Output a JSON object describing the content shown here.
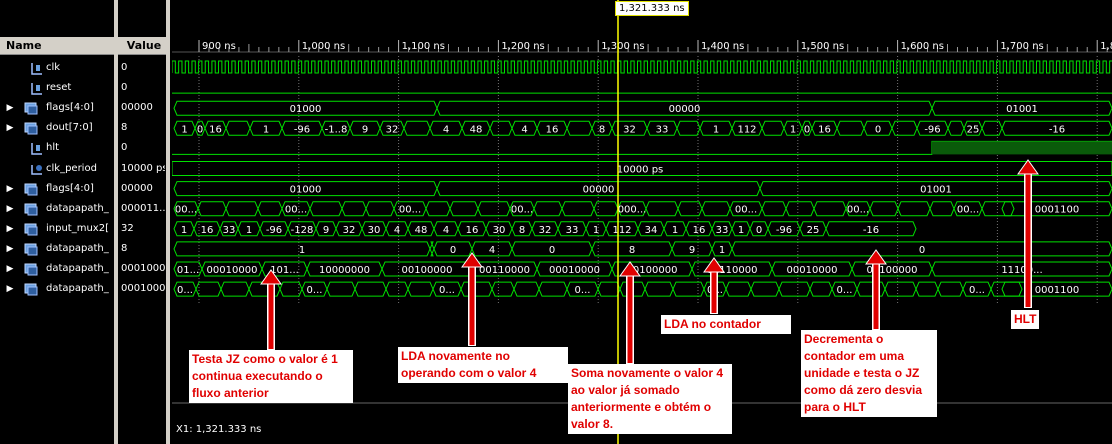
{
  "panel": {
    "name_header": "Name",
    "value_header": "Value"
  },
  "signals": [
    {
      "name": "clk",
      "value": "0",
      "kind": "bit",
      "expandable": false
    },
    {
      "name": "reset",
      "value": "0",
      "kind": "bit",
      "expandable": false
    },
    {
      "name": "flags[4:0]",
      "value": "00000",
      "kind": "bus",
      "expandable": true
    },
    {
      "name": "dout[7:0]",
      "value": "8",
      "kind": "bus",
      "expandable": true
    },
    {
      "name": "hlt",
      "value": "0",
      "kind": "bit",
      "expandable": false
    },
    {
      "name": "clk_period",
      "value": "10000 ps",
      "kind": "param",
      "expandable": false
    },
    {
      "name": "flags[4:0]",
      "value": "00000",
      "kind": "bus",
      "expandable": true
    },
    {
      "name": "datapapath_",
      "value": "000011...",
      "kind": "bus",
      "expandable": true
    },
    {
      "name": "input_mux2[",
      "value": "32",
      "kind": "bus",
      "expandable": true
    },
    {
      "name": "datapapath_",
      "value": "8",
      "kind": "bus",
      "expandable": true
    },
    {
      "name": "datapapath_",
      "value": "00010000",
      "kind": "bus",
      "expandable": true
    },
    {
      "name": "datapapath_",
      "value": "00010000",
      "kind": "bus",
      "expandable": true
    }
  ],
  "timeline": {
    "ticks": [
      "900 ns",
      "1,000 ns",
      "1,100 ns",
      "1,200 ns",
      "1,300 ns",
      "1,400 ns",
      "1,500 ns",
      "1,600 ns",
      "1,700 ns",
      "1,8"
    ],
    "cursor_label": "1,321.333 ns",
    "status": "X1: 1,321.333 ns"
  },
  "wave_texts": {
    "flags": [
      "01000",
      "00000",
      "01001"
    ],
    "dout": [
      "1",
      "0",
      "16",
      "1",
      "-96",
      "-1..8",
      "9",
      "32",
      "4",
      "48",
      "4",
      "16",
      "8",
      "32",
      "33",
      "1",
      "112",
      "1",
      "0",
      "16",
      "0",
      "-96",
      "25",
      "-16"
    ],
    "clk_period": "10000 ps",
    "flags2": [
      "01000",
      "00000",
      "01001"
    ],
    "dp1": [
      "00...",
      "00...",
      "000...",
      "00...",
      "00...",
      "00...",
      "00...",
      "0001100"
    ],
    "mux": [
      "1",
      "16",
      "33",
      "1",
      "-96",
      "-128",
      "9",
      "32",
      "30",
      "4",
      "48",
      "4",
      "16",
      "30",
      "8",
      "32",
      "33",
      "1",
      "112",
      "34",
      "1",
      "16",
      "33",
      "1",
      "0",
      "-96",
      "25",
      "-16"
    ],
    "dp3": [
      "1",
      "0",
      "4",
      "0",
      "8",
      "9",
      "1",
      "0"
    ],
    "dp4": [
      "01...",
      "00010000",
      "101...",
      "10000000",
      "00100000",
      "00110000",
      "00010000",
      "00100000",
      "01110000",
      "00010000",
      "00100000",
      "11100..."
    ],
    "dp5": [
      "0...",
      "0...",
      "000...",
      "0...",
      "0...",
      "0...",
      "0...",
      "0...",
      "0...",
      "0...",
      "0...",
      "0001100"
    ]
  },
  "annotations": [
    "Testa JZ como o valor é 1 continua executando o fluxo anterior",
    "LDA novamente no operando com o valor 4",
    "Soma novamente o valor 4 ao valor já somado anteriormente e obtém o valor 8.",
    "LDA no contador",
    "Decrementa o contador em uma unidade e testa o JZ como dá zero desvia para o HLT",
    "HLT"
  ],
  "colors": {
    "wave": "#00e000",
    "cursor": "#ffff00",
    "annotation_text": "#e00000",
    "arrow": "#e00000"
  }
}
